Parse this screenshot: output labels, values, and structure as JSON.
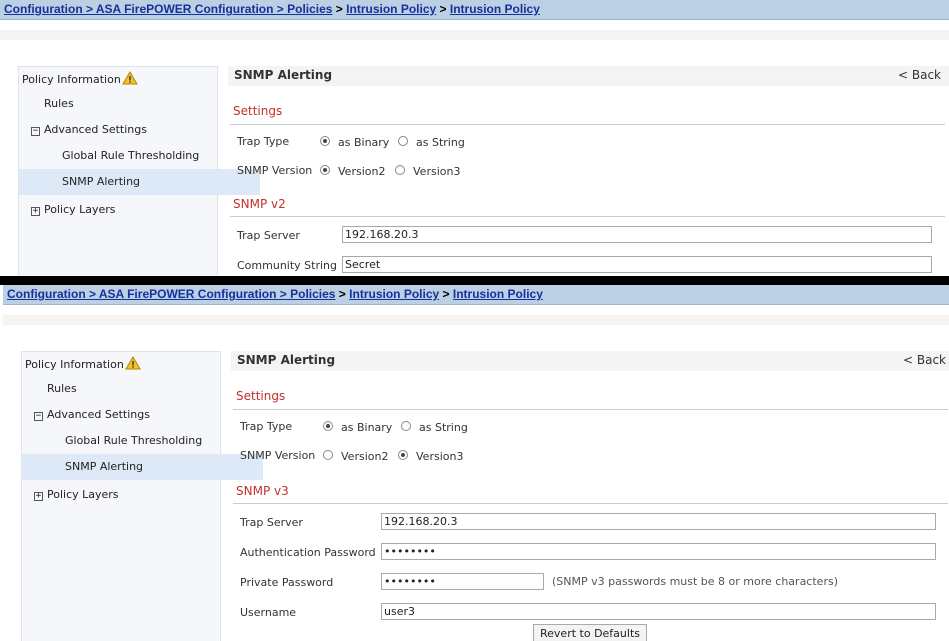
{
  "breadcrumb": {
    "items": [
      "Configuration > ASA FirePOWER Configuration > Policies",
      "Intrusion Policy",
      "Intrusion Policy"
    ],
    "separator": " > "
  },
  "sidebar": {
    "policy_information": "Policy Information",
    "rules": "Rules",
    "advanced_settings": "Advanced Settings",
    "global_rule_thresholding": "Global Rule Thresholding",
    "snmp_alerting": "SNMP Alerting",
    "policy_layers": "Policy Layers",
    "expand_symbol": "+",
    "collapse_symbol": "−"
  },
  "page": {
    "title": "SNMP Alerting",
    "back": "< Back",
    "settings_heading": "Settings",
    "trap_type_label": "Trap Type",
    "trap_type_binary": "as Binary",
    "trap_type_string": "as String",
    "snmp_version_label": "SNMP Version",
    "version2": "Version2",
    "version3": "Version3"
  },
  "panel1": {
    "trap_type_selected": "as Binary",
    "snmp_version_selected": "Version2",
    "section_heading": "SNMP v2",
    "trap_server_label": "Trap Server",
    "trap_server_value": "192.168.20.3",
    "community_label": "Community String",
    "community_value": "Secret"
  },
  "panel2": {
    "trap_type_selected": "as Binary",
    "snmp_version_selected": "Version3",
    "section_heading": "SNMP v3",
    "trap_server_label": "Trap Server",
    "trap_server_value": "192.168.20.3",
    "auth_password_label": "Authentication Password",
    "auth_password_value": "••••••••",
    "private_password_label": "Private Password",
    "private_password_value": "••••••••",
    "password_hint": "(SNMP v3 passwords must be 8 or more characters)",
    "username_label": "Username",
    "username_value": "user3",
    "revert_button": "Revert to Defaults"
  },
  "colors": {
    "breadcrumb_bg": "#bcd0e3",
    "link": "#16309c",
    "section_heading": "#c5302b",
    "sidebar_selected": "#dde9f7",
    "warning": "#f2c12e"
  }
}
